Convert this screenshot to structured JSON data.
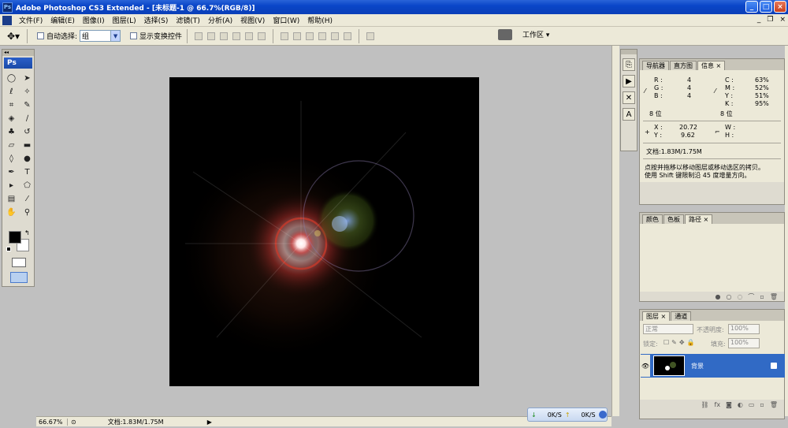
{
  "window": {
    "title": "Adobe Photoshop CS3 Extended - [未标题-1 @ 66.7%(RGB/8)]",
    "app_icon": "Ps"
  },
  "menu": {
    "items": [
      "文件(F)",
      "编辑(E)",
      "图像(I)",
      "图层(L)",
      "选择(S)",
      "滤镜(T)",
      "分析(A)",
      "视图(V)",
      "窗口(W)",
      "帮助(H)"
    ]
  },
  "options": {
    "auto_select_label": "自动选择:",
    "auto_select_value": "组",
    "show_transform_label": "显示变换控件",
    "workspace_label": "工作区 ▾"
  },
  "toolbox": {
    "badge": "Ps"
  },
  "status": {
    "zoom": "66.67%",
    "doc": "文档:1.83M/1.75M"
  },
  "net": {
    "down": "0K/S",
    "up": "0K/S"
  },
  "info_panel": {
    "tabs": [
      "导航器",
      "直方图",
      "信息"
    ],
    "r_label": "R :",
    "r": "4",
    "g_label": "G :",
    "g": "4",
    "b_label": "B :",
    "b": "4",
    "c_label": "C :",
    "c": "63%",
    "m_label": "M :",
    "m": "52%",
    "y_label": "Y :",
    "y": "51%",
    "k_label": "K :",
    "k": "95%",
    "bits_left": "8 位",
    "bits_right": "8 位",
    "x_label": "X :",
    "x": "20.72",
    "yy_label": "Y :",
    "yy": "9.62",
    "w_label": "W :",
    "h_label": "H :",
    "doc": "文档:1.83M/1.75M",
    "hint1": "点按并拖移以移动图层或移动选区的拷贝。",
    "hint2": "使用 Shift 键限制沿 45 度增量方向。"
  },
  "paths_panel": {
    "tabs": [
      "颜色",
      "色板",
      "路径"
    ]
  },
  "layers_panel": {
    "tabs": [
      "图层",
      "通道"
    ],
    "blend_mode": "正常",
    "opacity_label": "不透明度:",
    "opacity": "100%",
    "lock_label": "锁定:",
    "fill_label": "填充:",
    "fill": "100%",
    "layer_name": "背景"
  },
  "colors": {
    "canvas": "#000000",
    "accent": "#316ac5"
  }
}
